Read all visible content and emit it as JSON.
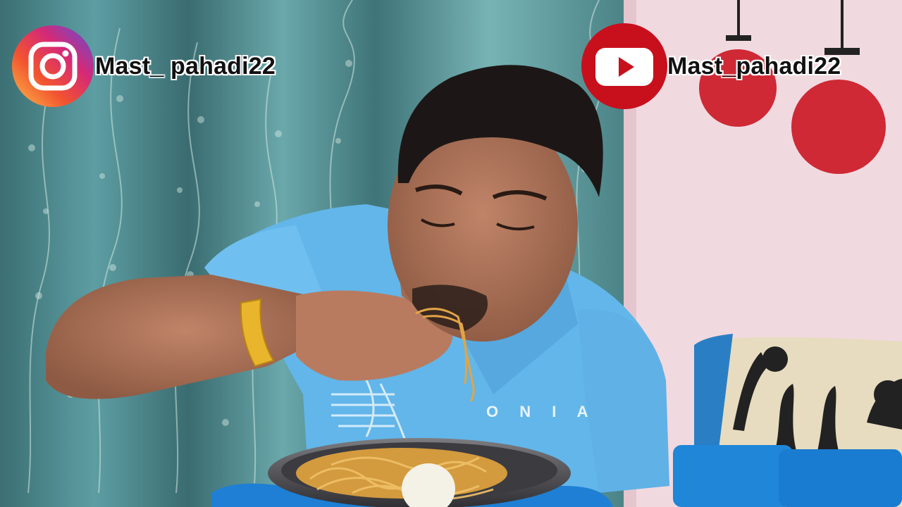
{
  "overlays": {
    "instagram": {
      "handle": "Mast_ pahadi22",
      "icon": "instagram-icon"
    },
    "youtube": {
      "handle": "Mast_pahadi22",
      "icon": "youtube-icon"
    }
  },
  "shirt": {
    "print_text": "O    N I A"
  },
  "colors": {
    "curtain": "#3f7a80",
    "wall": "#f1d9e0",
    "shirt": "#62b6ea",
    "youtube_red": "#c8101d",
    "sofa_blue": "#1f86d8"
  }
}
